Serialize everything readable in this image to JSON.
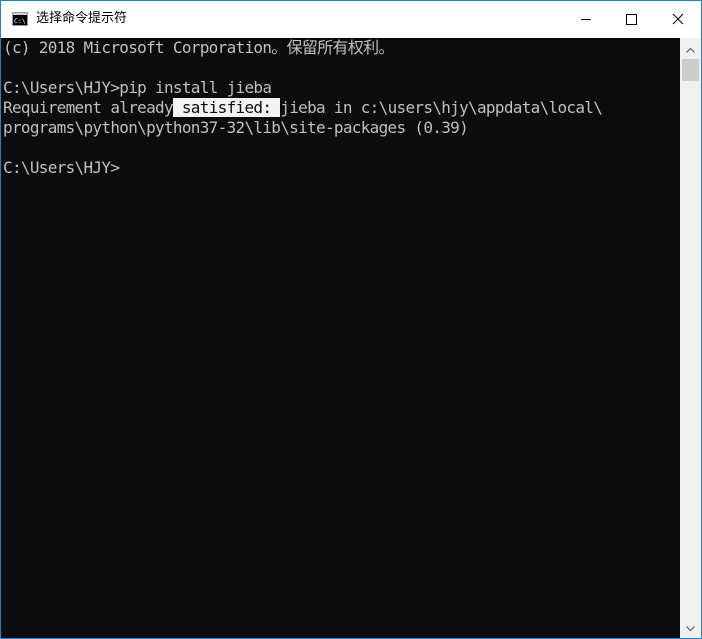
{
  "window": {
    "title": "选择命令提示符",
    "icon": "cmd-console-icon",
    "controls": {
      "minimize_icon": "minimize-icon",
      "maximize_icon": "maximize-icon",
      "close_icon": "close-icon"
    }
  },
  "console": {
    "line1": "(c) 2018 Microsoft Corporation。保留所有权利。",
    "line2": "",
    "line3": "C:\\Users\\HJY>pip install jieba",
    "line4_pre": "Requirement already",
    "line4_sel": " satisfied: ",
    "line4_post": "jieba in c:\\users\\hjy\\appdata\\local\\",
    "line5": "programs\\python\\python37-32\\lib\\site-packages (0.39)",
    "line6": "",
    "line7": "C:\\Users\\HJY>"
  },
  "colors": {
    "background": "#0c0c0c",
    "foreground": "#c0c0c0",
    "selection_bg": "#f2f2f2",
    "window_border": "#1883d7"
  }
}
